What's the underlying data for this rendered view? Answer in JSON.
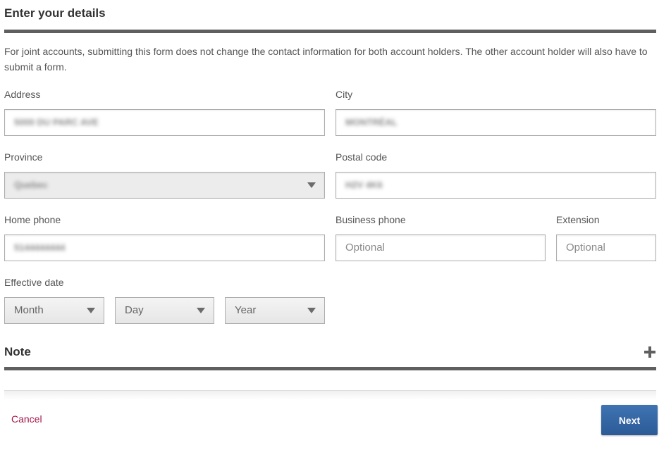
{
  "form": {
    "title": "Enter your details",
    "intro": "For joint accounts, submitting this form does not change the contact information for both account holders. The other account holder will also have to submit a form.",
    "address": {
      "label": "Address",
      "value": "5000 DU PARC AVE"
    },
    "city": {
      "label": "City",
      "value": "MONTRÉAL"
    },
    "province": {
      "label": "Province",
      "value": "Quebec"
    },
    "postal_code": {
      "label": "Postal code",
      "value": "H2V 4K6"
    },
    "home_phone": {
      "label": "Home phone",
      "value": "5144444444"
    },
    "business_phone": {
      "label": "Business phone",
      "placeholder": "Optional"
    },
    "extension": {
      "label": "Extension",
      "placeholder": "Optional"
    },
    "effective_date": {
      "label": "Effective date",
      "month": "Month",
      "day": "Day",
      "year": "Year"
    }
  },
  "note": {
    "title": "Note",
    "expand_icon": "plus-icon"
  },
  "footer": {
    "cancel_label": "Cancel",
    "next_label": "Next"
  },
  "colors": {
    "rule": "#5f5f5f",
    "link": "#a3174b",
    "primary_button": "#2c5b97"
  }
}
